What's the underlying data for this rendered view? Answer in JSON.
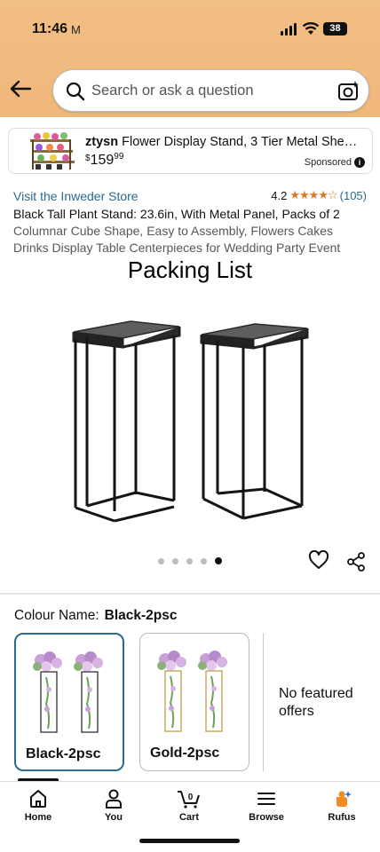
{
  "status_bar": {
    "time": "11:46",
    "mail_icon": "M",
    "battery": "38"
  },
  "search": {
    "placeholder": "Search or ask a question"
  },
  "ad": {
    "brand": "ztysn",
    "title": "Flower Display Stand, 3 Tier Metal She…",
    "price_symbol": "$",
    "price_whole": "159",
    "price_fraction": "99",
    "sponsored": "Sponsored",
    "info": "i"
  },
  "product": {
    "store_link": "Visit the Inweder Store",
    "rating": "4.2",
    "stars": "★★★★☆",
    "review_count": "(105)",
    "title_main": "Black Tall Plant Stand: 23.6in, With Metal Panel, Packs of 2",
    "title_rest": "Columnar Cube Shape, Easy to Assembly, Flowers Cakes Drinks Display Table Centerpieces for Wedding Party Event",
    "image_caption": "Packing List"
  },
  "variants": {
    "label": "Colour Name:",
    "selected": "Black-2psc",
    "options": [
      {
        "label": "Black-2psc",
        "selected": true
      },
      {
        "label": "Gold-2psc",
        "selected": false
      }
    ],
    "no_offers": "No featured offers"
  },
  "tabbar": {
    "home": "Home",
    "you": "You",
    "cart": "Cart",
    "cart_count": "0",
    "browse": "Browse",
    "rufus": "Rufus"
  },
  "colors": {
    "header_gradient_top": "#f2bf85",
    "link": "#2a6b8f",
    "star": "#de7921",
    "selected_border": "#2a6b8f"
  }
}
